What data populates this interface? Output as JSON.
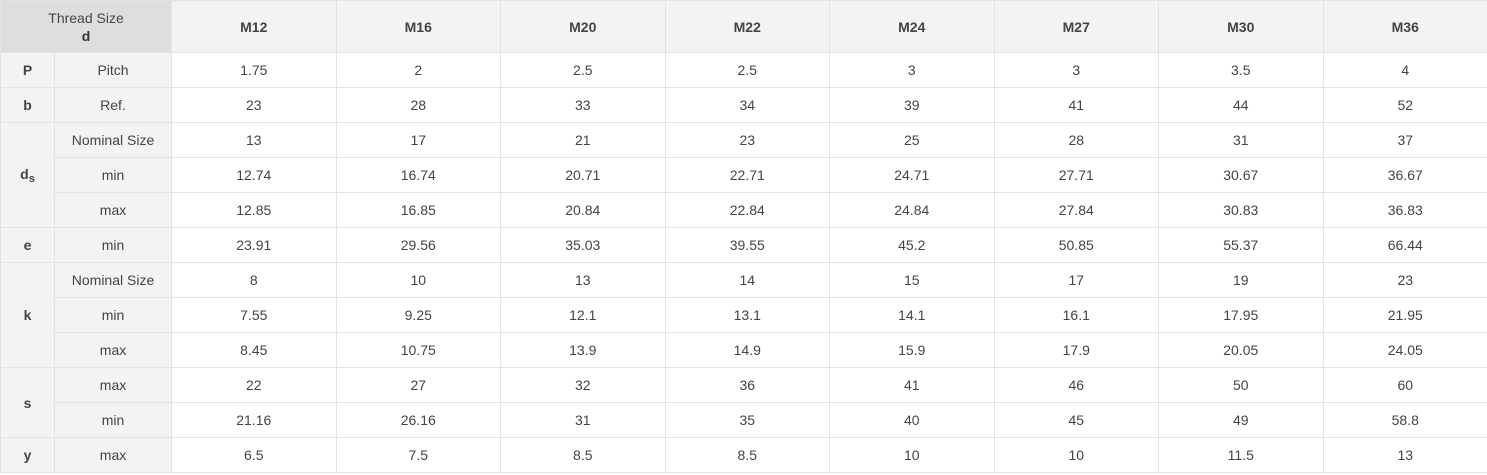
{
  "header": {
    "corner_label": "Thread Size",
    "corner_symbol": "d",
    "sizes": [
      "M12",
      "M16",
      "M20",
      "M22",
      "M24",
      "M27",
      "M30",
      "M36"
    ]
  },
  "groups": [
    {
      "symbol": "P",
      "subscript": "",
      "rows": [
        {
          "label": "Pitch",
          "values": [
            "1.75",
            "2",
            "2.5",
            "2.5",
            "3",
            "3",
            "3.5",
            "4"
          ]
        }
      ]
    },
    {
      "symbol": "b",
      "subscript": "",
      "rows": [
        {
          "label": "Ref.",
          "values": [
            "23",
            "28",
            "33",
            "34",
            "39",
            "41",
            "44",
            "52"
          ]
        }
      ]
    },
    {
      "symbol": "d",
      "subscript": "s",
      "rows": [
        {
          "label": "Nominal Size",
          "values": [
            "13",
            "17",
            "21",
            "23",
            "25",
            "28",
            "31",
            "37"
          ]
        },
        {
          "label": "min",
          "values": [
            "12.74",
            "16.74",
            "20.71",
            "22.71",
            "24.71",
            "27.71",
            "30.67",
            "36.67"
          ]
        },
        {
          "label": "max",
          "values": [
            "12.85",
            "16.85",
            "20.84",
            "22.84",
            "24.84",
            "27.84",
            "30.83",
            "36.83"
          ]
        }
      ]
    },
    {
      "symbol": "e",
      "subscript": "",
      "rows": [
        {
          "label": "min",
          "values": [
            "23.91",
            "29.56",
            "35.03",
            "39.55",
            "45.2",
            "50.85",
            "55.37",
            "66.44"
          ]
        }
      ]
    },
    {
      "symbol": "k",
      "subscript": "",
      "rows": [
        {
          "label": "Nominal Size",
          "values": [
            "8",
            "10",
            "13",
            "14",
            "15",
            "17",
            "19",
            "23"
          ]
        },
        {
          "label": "min",
          "values": [
            "7.55",
            "9.25",
            "12.1",
            "13.1",
            "14.1",
            "16.1",
            "17.95",
            "21.95"
          ]
        },
        {
          "label": "max",
          "values": [
            "8.45",
            "10.75",
            "13.9",
            "14.9",
            "15.9",
            "17.9",
            "20.05",
            "24.05"
          ]
        }
      ]
    },
    {
      "symbol": "s",
      "subscript": "",
      "rows": [
        {
          "label": "max",
          "values": [
            "22",
            "27",
            "32",
            "36",
            "41",
            "46",
            "50",
            "60"
          ]
        },
        {
          "label": "min",
          "values": [
            "21.16",
            "26.16",
            "31",
            "35",
            "40",
            "45",
            "49",
            "58.8"
          ]
        }
      ]
    },
    {
      "symbol": "y",
      "subscript": "",
      "rows": [
        {
          "label": "max",
          "values": [
            "6.5",
            "7.5",
            "8.5",
            "8.5",
            "10",
            "10",
            "11.5",
            "13"
          ]
        }
      ]
    }
  ]
}
